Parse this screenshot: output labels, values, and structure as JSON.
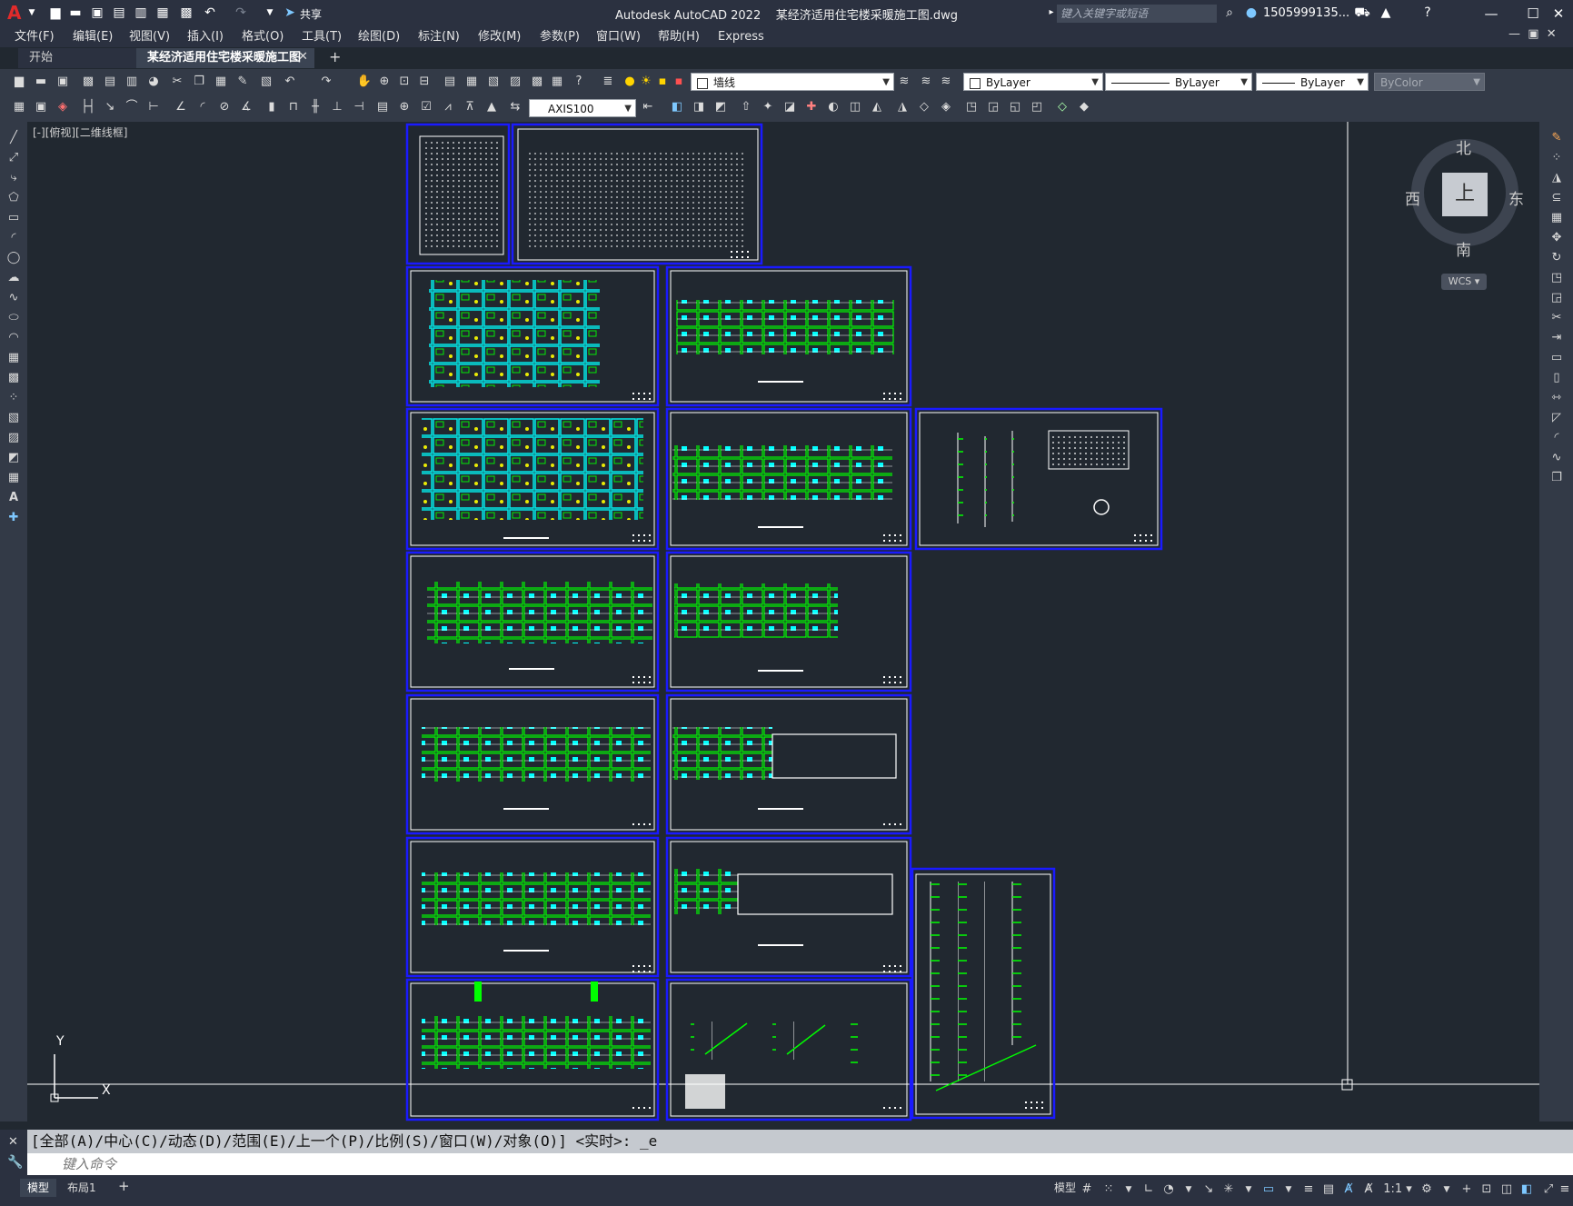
{
  "titlebar": {
    "app_title": "Autodesk AutoCAD 2022",
    "doc_title": "某经济适用住宅楼采暖施工图.dwg",
    "share_label": "共享",
    "search_placeholder": "键入关键字或短语",
    "user": "1505999135..."
  },
  "menu": [
    "文件(F)",
    "编辑(E)",
    "视图(V)",
    "插入(I)",
    "格式(O)",
    "工具(T)",
    "绘图(D)",
    "标注(N)",
    "修改(M)",
    "参数(P)",
    "窗口(W)",
    "帮助(H)",
    "Express"
  ],
  "tabs": {
    "start": "开始",
    "doc": "某经济适用住宅楼采暖施工图*"
  },
  "props": {
    "layer": "墙线",
    "color": "ByLayer",
    "linetype": "ByLayer",
    "lineweight": "ByLayer",
    "plotstyle": "ByColor",
    "dimstyle": "AXIS100"
  },
  "viewport_label": "[-][俯视][二维线框]",
  "viewcube": {
    "north": "北",
    "south": "南",
    "east": "东",
    "west": "西",
    "face": "上",
    "wcs": "WCS"
  },
  "ucs": {
    "x": "X",
    "y": "Y"
  },
  "command": {
    "history": "[全部(A)/中心(C)/动态(D)/范围(E)/上一个(P)/比例(S)/窗口(W)/对象(O)] <实时>: _e",
    "placeholder": "键入命令"
  },
  "status": {
    "model_tab": "模型",
    "layout_tab": "布局1",
    "model_btn": "模型",
    "scale": "1:1"
  },
  "colors": {
    "frame": "#1a1aff",
    "plan_green": "#00ff00",
    "plan_cyan": "#00ffff",
    "canvas": "#212830"
  }
}
